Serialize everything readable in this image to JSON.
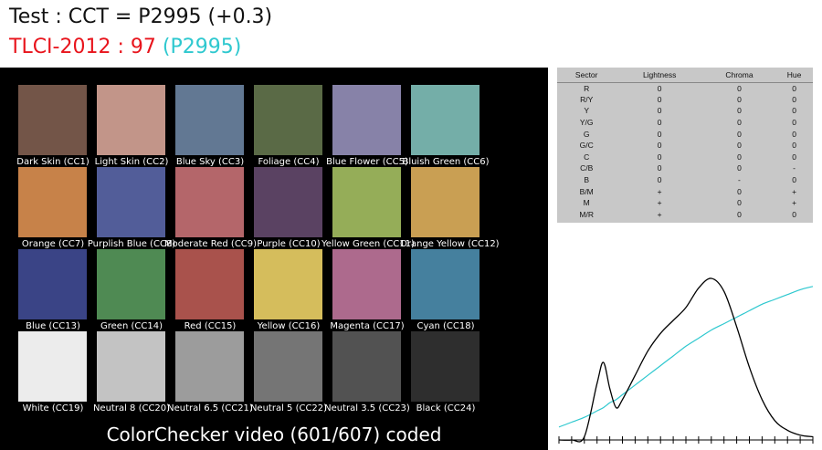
{
  "header": {
    "cct_line": "Test : CCT = P2995 (+0.3)",
    "tlci_label": "TLCI-2012 : 97",
    "tlci_ref": " (P2995)"
  },
  "checker": {
    "caption": "ColorChecker video (601/607) coded",
    "patches": [
      {
        "label": "Dark Skin (CC1)",
        "color": "#735548"
      },
      {
        "label": "Light Skin (CC2)",
        "color": "#c29589"
      },
      {
        "label": "Blue Sky (CC3)",
        "color": "#627893"
      },
      {
        "label": "Foliage (CC4)",
        "color": "#5a6a46"
      },
      {
        "label": "Blue Flower (CC5)",
        "color": "#8782a8"
      },
      {
        "label": "Bluish Green (CC6)",
        "color": "#74aea8"
      },
      {
        "label": "Orange (CC7)",
        "color": "#c78249"
      },
      {
        "label": "Purplish Blue (CC8)",
        "color": "#525d99"
      },
      {
        "label": "Moderate Red (CC9)",
        "color": "#b4666a"
      },
      {
        "label": "Purple (CC10)",
        "color": "#5a4262"
      },
      {
        "label": "Yellow Green (CC11)",
        "color": "#95ad58"
      },
      {
        "label": "Orange Yellow (CC12)",
        "color": "#c99f53"
      },
      {
        "label": "Blue (CC13)",
        "color": "#3a4486"
      },
      {
        "label": "Green (CC14)",
        "color": "#4f8a53"
      },
      {
        "label": "Red (CC15)",
        "color": "#a9524c"
      },
      {
        "label": "Yellow (CC16)",
        "color": "#d5bd5c"
      },
      {
        "label": "Magenta (CC17)",
        "color": "#ad6a8d"
      },
      {
        "label": "Cyan (CC18)",
        "color": "#45809e"
      },
      {
        "label": "White (CC19)",
        "color": "#ececec"
      },
      {
        "label": "Neutral 8 (CC20)",
        "color": "#c3c3c3"
      },
      {
        "label": "Neutral 6.5 (CC21)",
        "color": "#9c9c9c"
      },
      {
        "label": "Neutral 5 (CC22)",
        "color": "#757575"
      },
      {
        "label": "Neutral 3.5 (CC23)",
        "color": "#525252"
      },
      {
        "label": "Black (CC24)",
        "color": "#2e2e2e"
      }
    ]
  },
  "sector_table": {
    "headers": [
      "Sector",
      "Lightness",
      "Chroma",
      "Hue"
    ],
    "rows": [
      [
        "R",
        "0",
        "0",
        "0"
      ],
      [
        "R/Y",
        "0",
        "0",
        "0"
      ],
      [
        "Y",
        "0",
        "0",
        "0"
      ],
      [
        "Y/G",
        "0",
        "0",
        "0"
      ],
      [
        "G",
        "0",
        "0",
        "0"
      ],
      [
        "G/C",
        "0",
        "0",
        "0"
      ],
      [
        "C",
        "0",
        "0",
        "0"
      ],
      [
        "C/B",
        "0",
        "0",
        "-"
      ],
      [
        "B",
        "0",
        "-",
        "0"
      ],
      [
        "B/M",
        "+",
        "0",
        "+"
      ],
      [
        "M",
        "+",
        "0",
        "+"
      ],
      [
        "M/R",
        "+",
        "0",
        "0"
      ]
    ]
  },
  "colors": {
    "test_line": "#e8141c",
    "ref_line": "#2ec8cf",
    "spectrum_test": "#000000",
    "spectrum_ref": "#2ec8cf"
  },
  "chart_data": {
    "type": "line",
    "x": [
      380,
      400,
      420,
      440,
      450,
      460,
      470,
      480,
      500,
      520,
      540,
      560,
      580,
      600,
      620,
      640,
      660,
      680,
      700,
      720,
      740,
      760,
      780
    ],
    "series": [
      {
        "values": [
          0.0,
          0.0,
          0.02,
          0.35,
          0.48,
          0.32,
          0.2,
          0.25,
          0.4,
          0.55,
          0.66,
          0.74,
          0.82,
          0.94,
          1.0,
          0.92,
          0.7,
          0.45,
          0.25,
          0.12,
          0.06,
          0.03,
          0.02
        ]
      },
      {
        "values": [
          0.08,
          0.11,
          0.14,
          0.18,
          0.2,
          0.23,
          0.25,
          0.28,
          0.34,
          0.4,
          0.46,
          0.52,
          0.58,
          0.63,
          0.68,
          0.72,
          0.76,
          0.8,
          0.84,
          0.87,
          0.9,
          0.93,
          0.95
        ]
      }
    ],
    "xlim": [
      380,
      780
    ],
    "ylim": [
      0,
      1
    ],
    "grid": false,
    "title": "",
    "xlabel": "",
    "ylabel": ""
  }
}
